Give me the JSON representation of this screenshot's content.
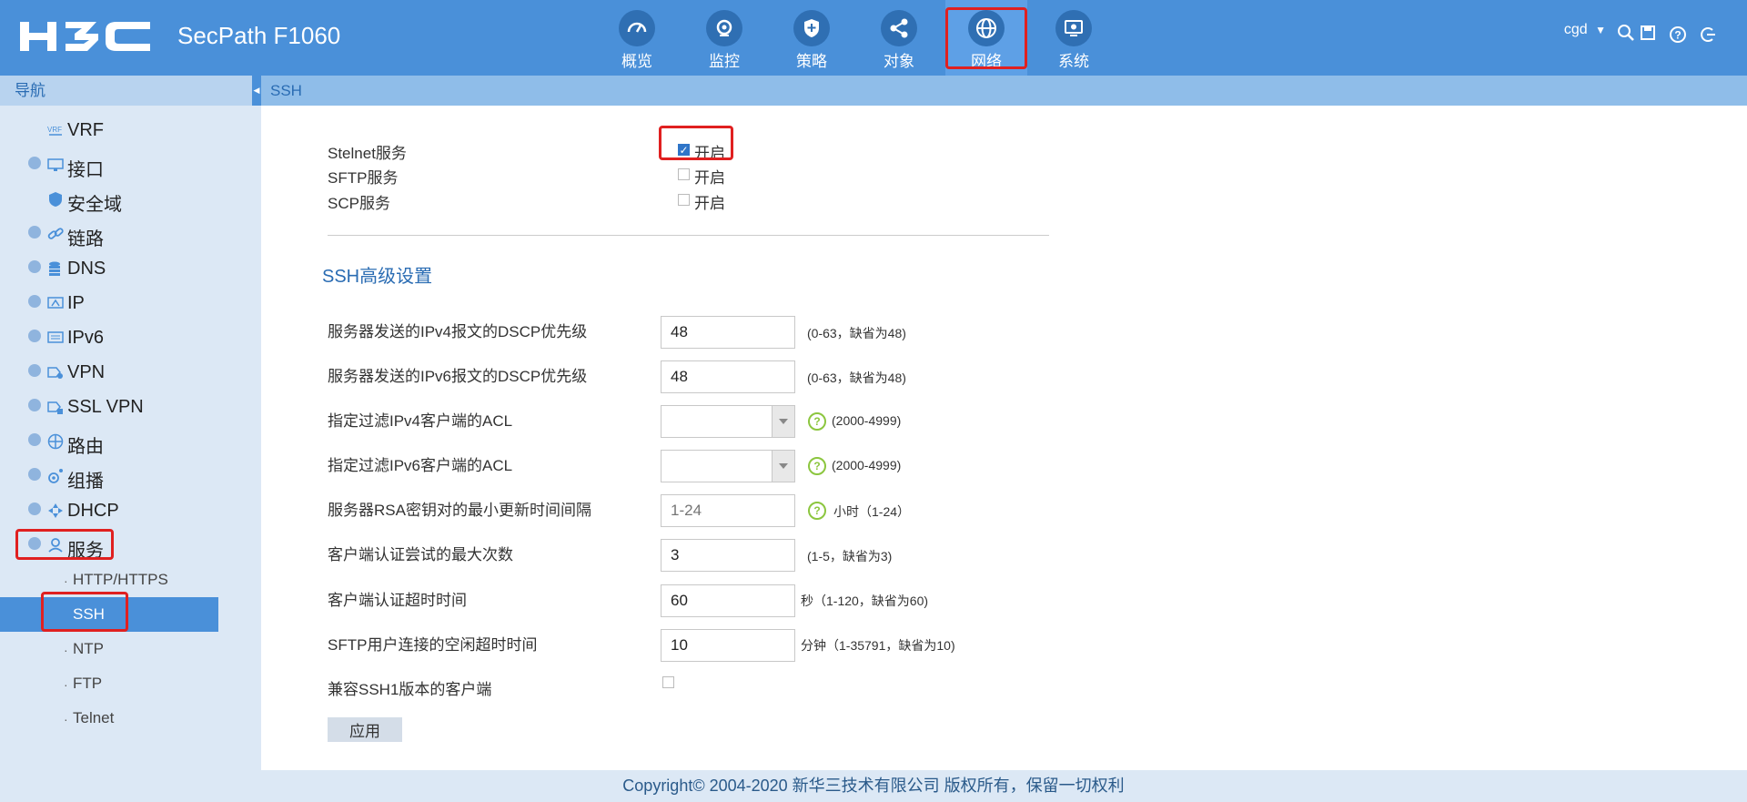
{
  "header": {
    "brand": "H3C",
    "product": "SecPath F1060",
    "tabs": [
      {
        "label": "概览",
        "icon": "gauge-icon"
      },
      {
        "label": "监控",
        "icon": "monitor-eye-icon"
      },
      {
        "label": "策略",
        "icon": "shield-plus-icon"
      },
      {
        "label": "对象",
        "icon": "share-nodes-icon"
      },
      {
        "label": "网络",
        "icon": "globe-icon",
        "active": true
      },
      {
        "label": "系统",
        "icon": "screen-gear-icon"
      }
    ],
    "user": "cgd",
    "tools": [
      "search-icon",
      "save-icon",
      "help-icon",
      "logout-icon"
    ]
  },
  "sidebar": {
    "title": "导航",
    "items": [
      {
        "label": "VRF",
        "icon": "vrf-icon"
      },
      {
        "label": "接口",
        "icon": "interface-icon"
      },
      {
        "label": "安全域",
        "icon": "shield-icon"
      },
      {
        "label": "链路",
        "icon": "link-icon"
      },
      {
        "label": "DNS",
        "icon": "database-icon"
      },
      {
        "label": "IP",
        "icon": "ip-icon"
      },
      {
        "label": "IPv6",
        "icon": "ipv6-icon"
      },
      {
        "label": "VPN",
        "icon": "vpn-icon"
      },
      {
        "label": "SSL VPN",
        "icon": "sslvpn-icon"
      },
      {
        "label": "路由",
        "icon": "route-icon"
      },
      {
        "label": "组播",
        "icon": "multicast-icon"
      },
      {
        "label": "DHCP",
        "icon": "dhcp-icon"
      },
      {
        "label": "服务",
        "icon": "service-icon"
      }
    ],
    "subitems": [
      "HTTP/HTTPS",
      "SSH",
      "NTP",
      "FTP",
      "Telnet"
    ],
    "active_sub": "SSH"
  },
  "breadcrumb": "SSH",
  "services": [
    {
      "label": "Stelnet服务",
      "option": "开启",
      "checked": true
    },
    {
      "label": "SFTP服务",
      "option": "开启",
      "checked": false
    },
    {
      "label": "SCP服务",
      "option": "开启",
      "checked": false
    }
  ],
  "advanced": {
    "title": "SSH高级设置",
    "fields": [
      {
        "label": "服务器发送的IPv4报文的DSCP优先级",
        "value": "48",
        "hint": "(0-63，缺省为48)"
      },
      {
        "label": "服务器发送的IPv6报文的DSCP优先级",
        "value": "48",
        "hint": "(0-63，缺省为48)"
      },
      {
        "label": "指定过滤IPv4客户端的ACL",
        "value": "",
        "hint": "(2000-4999)"
      },
      {
        "label": "指定过滤IPv6客户端的ACL",
        "value": "",
        "hint": "(2000-4999)"
      },
      {
        "label": "服务器RSA密钥对的最小更新时间间隔",
        "placeholder": "1-24",
        "hint": "小时（1-24）"
      },
      {
        "label": "客户端认证尝试的最大次数",
        "value": "3",
        "hint": "(1-5，缺省为3)"
      },
      {
        "label": "客户端认证超时时间",
        "value": "60",
        "hint": "秒（1-120，缺省为60)"
      },
      {
        "label": "SFTP用户连接的空闲超时时间",
        "value": "10",
        "hint": "分钟（1-35791，缺省为10)"
      }
    ],
    "ssh1_label": "兼容SSH1版本的客户端",
    "ssh1_checked": false,
    "apply_label": "应用"
  },
  "footer": "Copyright© 2004-2020 新华三技术有限公司 版权所有，保留一切权利",
  "colors": {
    "header": "#4a90d9",
    "sidebar": "#dce8f5",
    "accent": "#2a6cb3",
    "highlight": "#e02020"
  }
}
